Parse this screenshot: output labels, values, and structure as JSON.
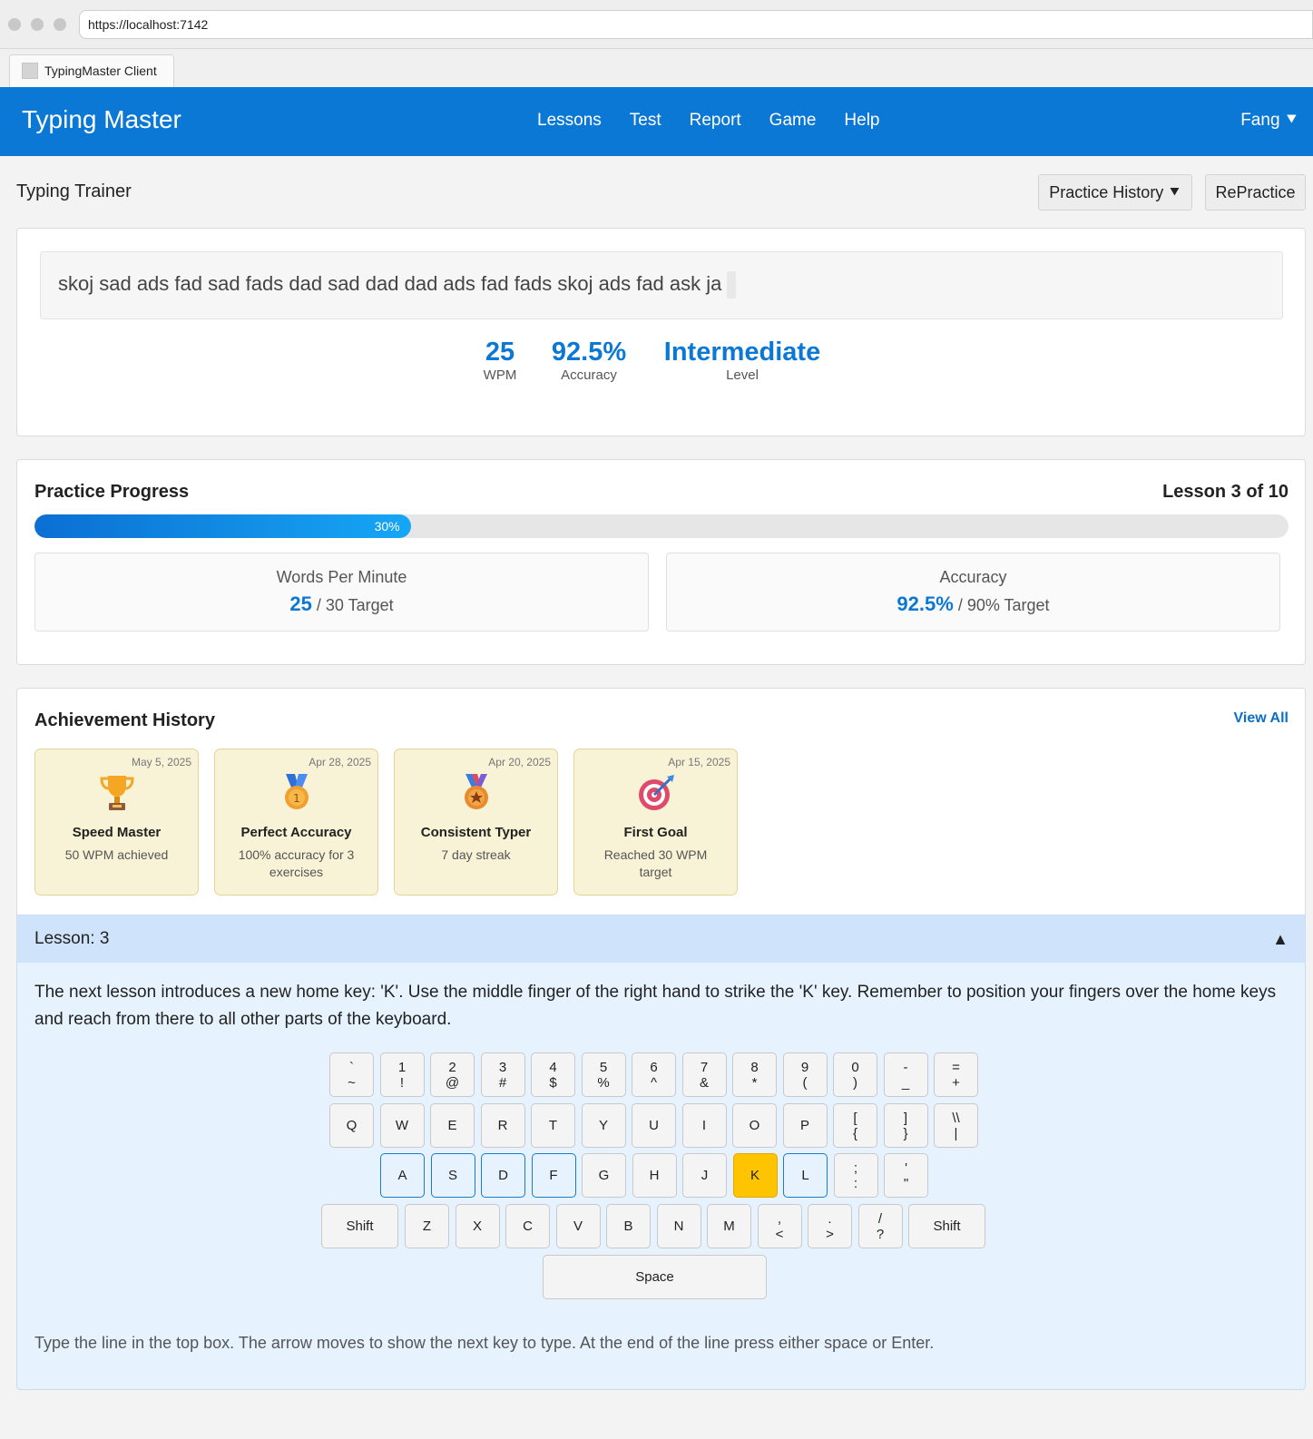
{
  "browser": {
    "url": "https://localhost:7142",
    "tab_title": "TypingMaster Client"
  },
  "header": {
    "brand": "Typing Master",
    "nav": [
      "Lessons",
      "Test",
      "Report",
      "Game",
      "Help"
    ],
    "user": "Fang ⯆"
  },
  "page": {
    "title": "Typing Trainer",
    "history_button": "Practice History ⯆",
    "repractice_button": "RePractice"
  },
  "typing": {
    "line": "skoj sad ads fad sad fads dad sad dad dad ads fad fads skoj ads fad ask ja",
    "stats": [
      {
        "value": "25",
        "label": "WPM"
      },
      {
        "value": "92.5%",
        "label": "Accuracy"
      },
      {
        "value": "Intermediate",
        "label": "Level"
      }
    ]
  },
  "progress": {
    "title": "Practice Progress",
    "lesson_of": "Lesson 3 of 10",
    "percent_label": "30%",
    "percent_value": 0.3,
    "metrics": [
      {
        "title": "Words Per Minute",
        "value": "25",
        "target": "/ 30 Target"
      },
      {
        "title": "Accuracy",
        "value": "92.5%",
        "target": "/ 90% Target"
      }
    ]
  },
  "achievements": {
    "title": "Achievement History",
    "view_all": "View All",
    "items": [
      {
        "date": "May 5, 2025",
        "icon": "trophy-icon",
        "name": "Speed Master",
        "desc": "50 WPM achieved"
      },
      {
        "date": "Apr 28, 2025",
        "icon": "medal-icon",
        "name": "Perfect Accuracy",
        "desc": "100% accuracy for 3 exercises"
      },
      {
        "date": "Apr 20, 2025",
        "icon": "star-medal-icon",
        "name": "Consistent Typer",
        "desc": "7 day streak"
      },
      {
        "date": "Apr 15, 2025",
        "icon": "target-icon",
        "name": "First Goal",
        "desc": "Reached 30 WPM target"
      }
    ]
  },
  "lesson": {
    "header": "Lesson: 3",
    "text": "The next lesson introduces a new home key: 'K'. Use the middle finger of the right hand to strike the 'K' key. Remember to position your fingers over the home keys and reach from there to all other parts of the keyboard.",
    "hint": "Type the line in the top box. The arrow moves to show the next key to type. At the end of the line press either space or Enter."
  },
  "keyboard": {
    "row1": [
      [
        "`",
        "~"
      ],
      [
        "1",
        "!"
      ],
      [
        "2",
        "@"
      ],
      [
        "3",
        "#"
      ],
      [
        "4",
        "$"
      ],
      [
        "5",
        "%"
      ],
      [
        "6",
        "^"
      ],
      [
        "7",
        "&"
      ],
      [
        "8",
        "*"
      ],
      [
        "9",
        "("
      ],
      [
        "0",
        ")"
      ],
      [
        "-",
        "_"
      ],
      [
        "=",
        "+"
      ]
    ],
    "row2": [
      [
        "Q"
      ],
      [
        "W"
      ],
      [
        "E"
      ],
      [
        "R"
      ],
      [
        "T"
      ],
      [
        "Y"
      ],
      [
        "U"
      ],
      [
        "I"
      ],
      [
        "O"
      ],
      [
        "P"
      ],
      [
        "[",
        "{"
      ],
      [
        "]",
        "}"
      ],
      [
        "\\\\",
        "|"
      ]
    ],
    "row3": [
      [
        "A"
      ],
      [
        "S"
      ],
      [
        "D"
      ],
      [
        "F"
      ],
      [
        "G"
      ],
      [
        "H"
      ],
      [
        "J"
      ],
      [
        "K"
      ],
      [
        "L"
      ],
      [
        ";",
        ":"
      ],
      [
        "'",
        "\""
      ]
    ],
    "row4": [
      [
        "Shift"
      ],
      [
        "Z"
      ],
      [
        "X"
      ],
      [
        "C"
      ],
      [
        "V"
      ],
      [
        "B"
      ],
      [
        "N"
      ],
      [
        "M"
      ],
      [
        ",",
        "<"
      ],
      [
        ".",
        ">"
      ],
      [
        "/",
        "?"
      ],
      [
        "Shift"
      ]
    ],
    "space": "Space",
    "home_keys": [
      "A",
      "S",
      "D",
      "F",
      "L"
    ],
    "active_key": "K"
  }
}
